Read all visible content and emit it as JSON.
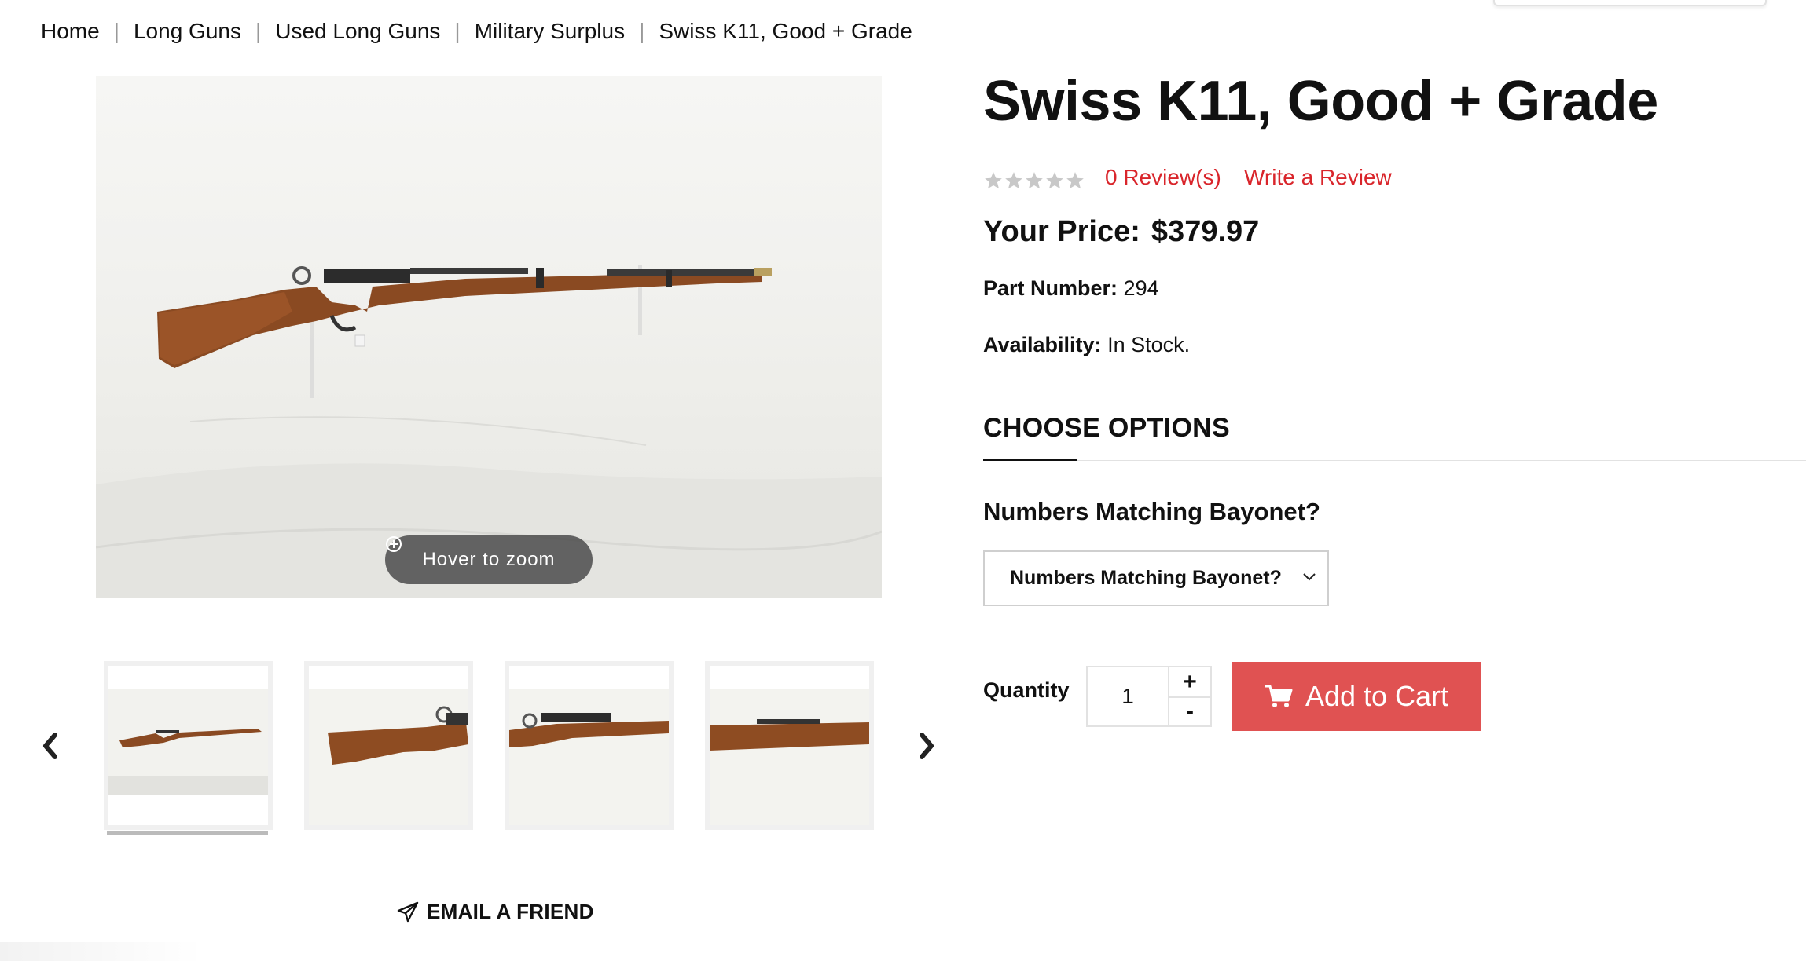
{
  "breadcrumb": {
    "items": [
      "Home",
      "Long Guns",
      "Used Long Guns",
      "Military Surplus",
      "Swiss K11, Good + Grade"
    ],
    "separator": "|"
  },
  "gallery": {
    "zoom_hint": "Hover to zoom",
    "thumbnails_count": 4,
    "active_thumbnail": 1,
    "email_friend": "EMAIL A FRIEND"
  },
  "product": {
    "title": "Swiss K11, Good + Grade",
    "rating": 0,
    "reviews_link": "0 Review(s)",
    "write_review": "Write a Review",
    "price_label": "Your Price:",
    "price_value": "$379.97",
    "part_number_label": "Part Number:",
    "part_number_value": "294",
    "availability_label": "Availability:",
    "availability_value": "In Stock."
  },
  "options": {
    "heading": "CHOOSE OPTIONS",
    "option_label": "Numbers Matching Bayonet?",
    "select_value": "Numbers Matching Bayonet?"
  },
  "purchase": {
    "quantity_label": "Quantity",
    "quantity_value": "1",
    "plus": "+",
    "minus": "-",
    "add_to_cart": "Add to Cart"
  },
  "colors": {
    "accent_red": "#d9252b",
    "cart_button": "#e05252",
    "text": "#111111"
  }
}
